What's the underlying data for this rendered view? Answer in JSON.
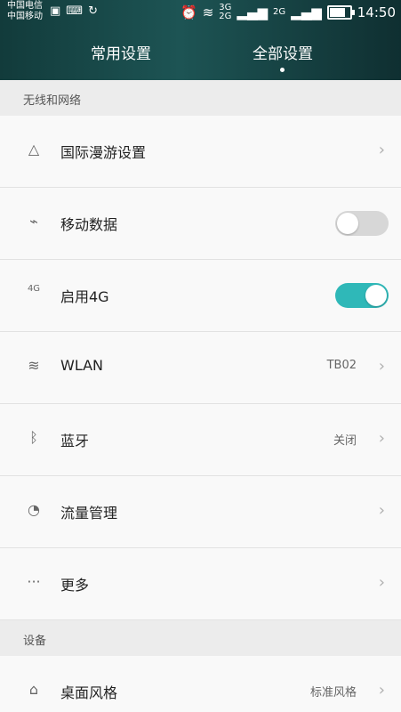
{
  "status_bar": {
    "carrier1": "中国电信",
    "carrier2": "中国移动",
    "time": "14:50",
    "net3g": "3G",
    "net2g": "2G",
    "net2g_b": "2G"
  },
  "tabs": [
    {
      "label": "常用设置",
      "active": false
    },
    {
      "label": "全部设置",
      "active": true
    }
  ],
  "sections": {
    "wireless": "无线和网络",
    "device": "设备"
  },
  "items": {
    "roaming": {
      "label": "国际漫游设置",
      "icon": "triangle-icon"
    },
    "mobile_data": {
      "label": "移动数据",
      "icon": "signal-icon",
      "enabled": false
    },
    "enable_4g": {
      "label": "启用4G",
      "icon": "4g-signal-icon",
      "enabled": true,
      "icon_text": "4G"
    },
    "wlan": {
      "label": "WLAN",
      "value": "TB02",
      "icon": "wifi-icon"
    },
    "bluetooth": {
      "label": "蓝牙",
      "value": "关闭",
      "icon": "bluetooth-icon"
    },
    "data_usage": {
      "label": "流量管理",
      "icon": "gauge-icon"
    },
    "more": {
      "label": "更多",
      "icon": "more-icon"
    },
    "theme": {
      "label": "桌面风格",
      "value": "标准风格",
      "icon": "home-icon"
    }
  },
  "colors": {
    "accent": "#2fb8b8",
    "header": "#1d5454"
  },
  "battery_level": 0.8
}
